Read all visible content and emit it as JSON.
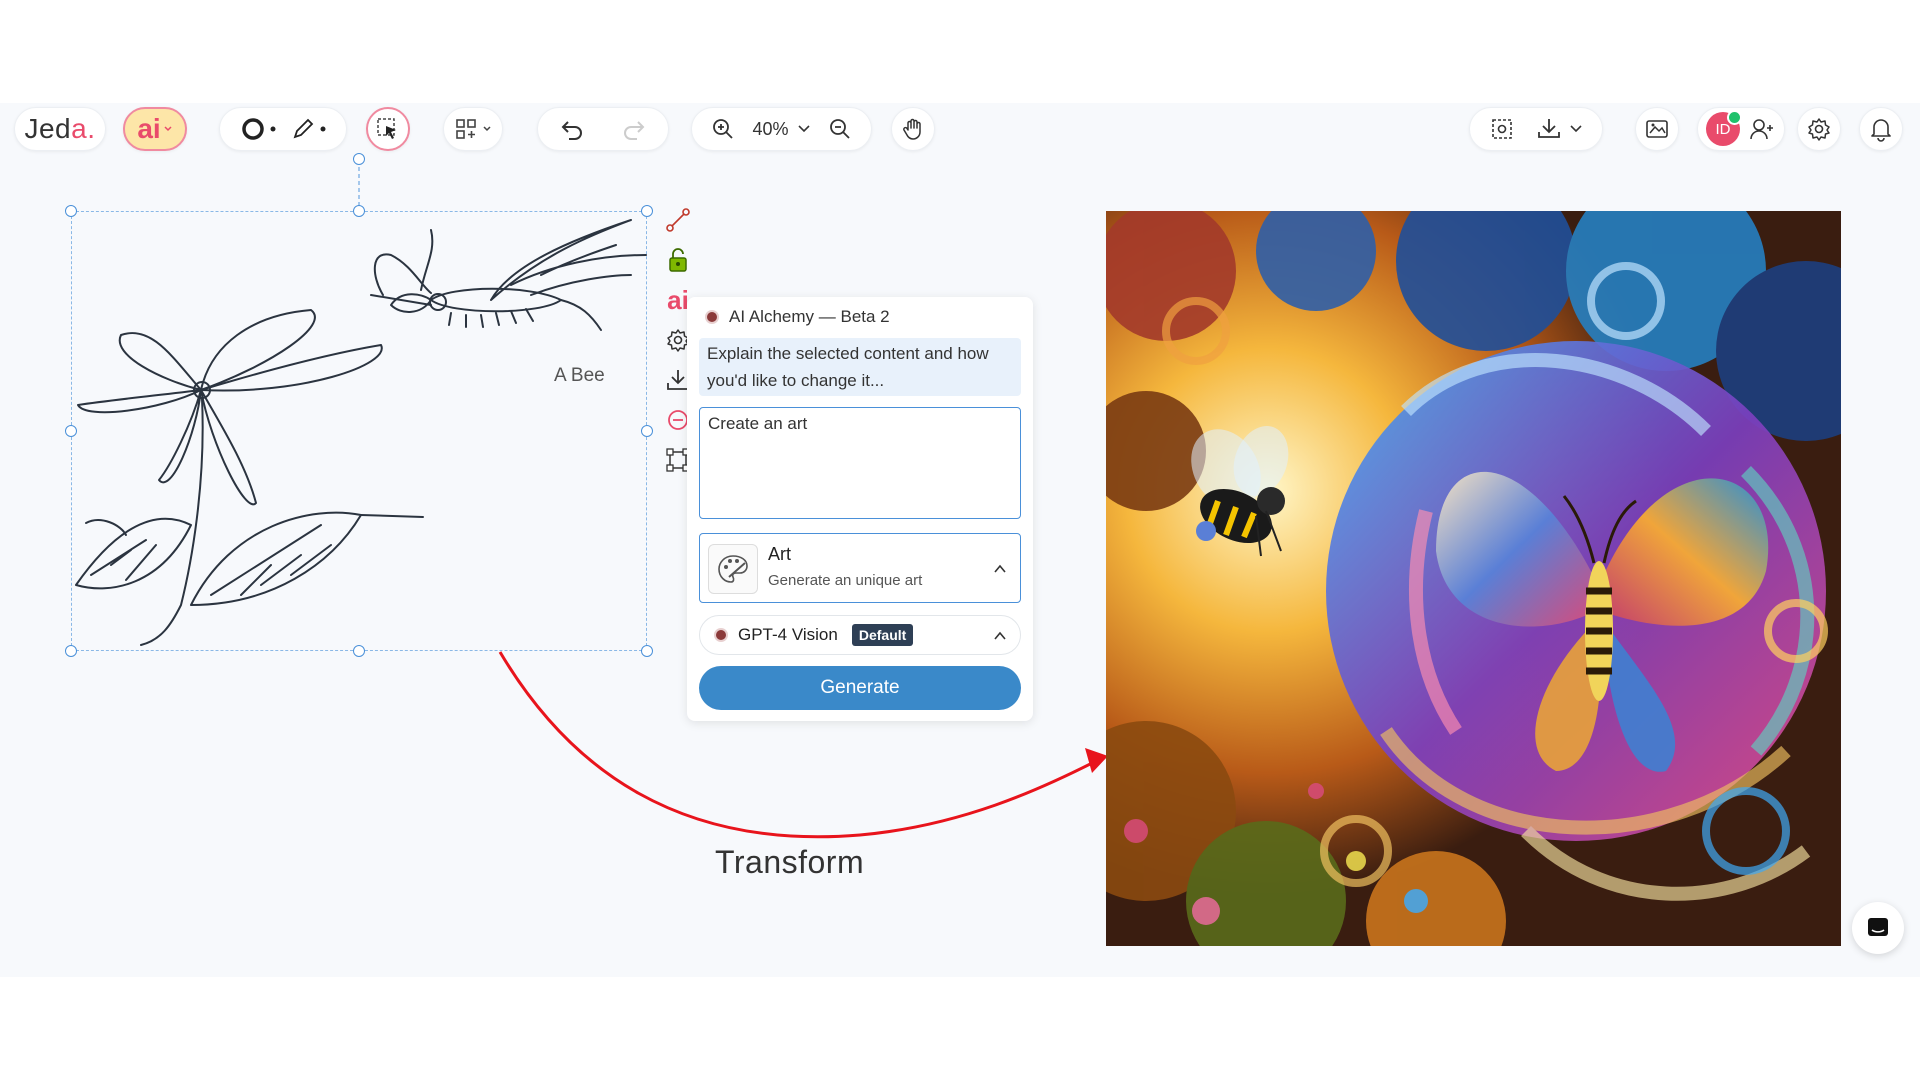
{
  "app": {
    "logo_main": "Jed",
    "logo_accent": "a.",
    "ai_label": "ai"
  },
  "toolbar": {
    "zoom_level": "40%"
  },
  "canvas": {
    "sketch_label": "A Bee",
    "transform_label": "Transform"
  },
  "panel": {
    "title": "AI Alchemy — Beta 2",
    "hint": "Explain the selected content and how you'd like to change it...",
    "input_value": "Create an art",
    "mode": {
      "title": "Art",
      "subtitle": "Generate an unique art"
    },
    "model": {
      "name": "GPT-4 Vision",
      "badge": "Default"
    },
    "generate_label": "Generate"
  },
  "user": {
    "avatar_initials": "ID"
  },
  "colors": {
    "accent": "#e94b6b",
    "primary": "#3a89c9",
    "selection": "#4a90d9",
    "arrow": "#e8141c"
  }
}
